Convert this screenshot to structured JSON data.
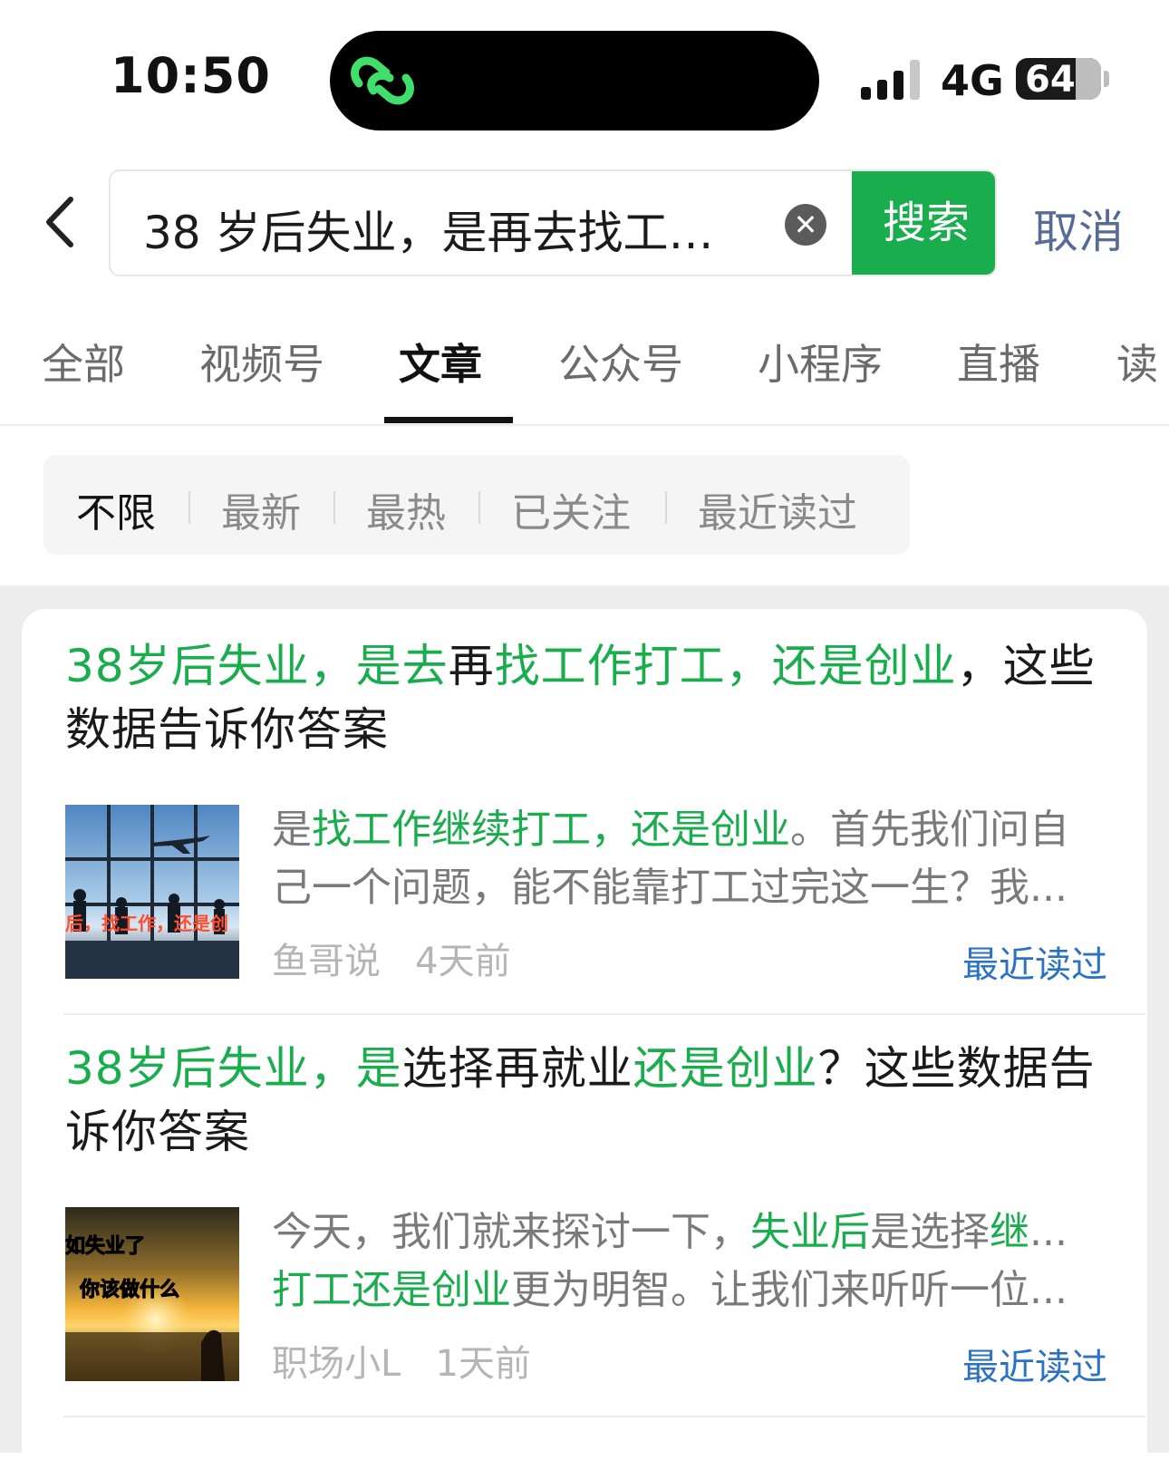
{
  "status_bar": {
    "time": "10:50",
    "network": "4G",
    "battery": "64",
    "signal_bars": 4,
    "signal_bars_filled": 3
  },
  "search": {
    "query": "38 岁后失业，是再去找工…",
    "button_label": "搜索",
    "cancel_label": "取消"
  },
  "tabs": [
    {
      "label": "全部"
    },
    {
      "label": "视频号"
    },
    {
      "label": "文章",
      "active": true
    },
    {
      "label": "公众号"
    },
    {
      "label": "小程序"
    },
    {
      "label": "直播"
    },
    {
      "label": "读"
    }
  ],
  "filters": [
    {
      "label": "不限",
      "active": true
    },
    {
      "label": "最新"
    },
    {
      "label": "最热"
    },
    {
      "label": "已关注"
    },
    {
      "label": "最近读过"
    }
  ],
  "results": [
    {
      "title_parts": [
        {
          "text": "38岁后失业，是去",
          "hl": true
        },
        {
          "text": "再",
          "hl": false
        },
        {
          "text": "找工作打工，还是创业",
          "hl": true
        },
        {
          "text": "，这些数据告诉你答案",
          "hl": false
        }
      ],
      "snippet_line1_parts": [
        {
          "text": "是",
          "hl": false
        },
        {
          "text": "找工作继续打工，还是创业",
          "hl": true
        },
        {
          "text": "。首先我们问自",
          "hl": false
        }
      ],
      "snippet_line2_parts": [
        {
          "text": "己一个问题，能不能靠打工过完这一生？我...",
          "hl": false
        }
      ],
      "thumb_caption": "后，找工作，还是创",
      "source": "鱼哥说",
      "time_ago": "4天前",
      "badge": "最近读过"
    },
    {
      "title_parts": [
        {
          "text": "38岁后失业，是",
          "hl": true
        },
        {
          "text": "选择再就业",
          "hl": false
        },
        {
          "text": "还是创业",
          "hl": true
        },
        {
          "text": "？这些数据告诉你答案",
          "hl": false
        }
      ],
      "snippet_line1_parts": [
        {
          "text": "今天，我们就来探讨一下，",
          "hl": false
        },
        {
          "text": "失业后",
          "hl": true
        },
        {
          "text": "是选择",
          "hl": false
        },
        {
          "text": "继",
          "hl": true
        },
        {
          "text": "...",
          "hl": false
        }
      ],
      "snippet_line2_parts": [
        {
          "text": "打工还是创业",
          "hl": true
        },
        {
          "text": "更为明智。让我们来听听一位...",
          "hl": false
        }
      ],
      "thumb_caption_1": "如失业了",
      "thumb_caption_2": "你该做什么",
      "source": "职场小L",
      "time_ago": "1天前",
      "badge": "最近读过"
    }
  ],
  "colors": {
    "highlight": "#1aad4e",
    "link": "#2b72c4",
    "cancel": "#576b95"
  }
}
